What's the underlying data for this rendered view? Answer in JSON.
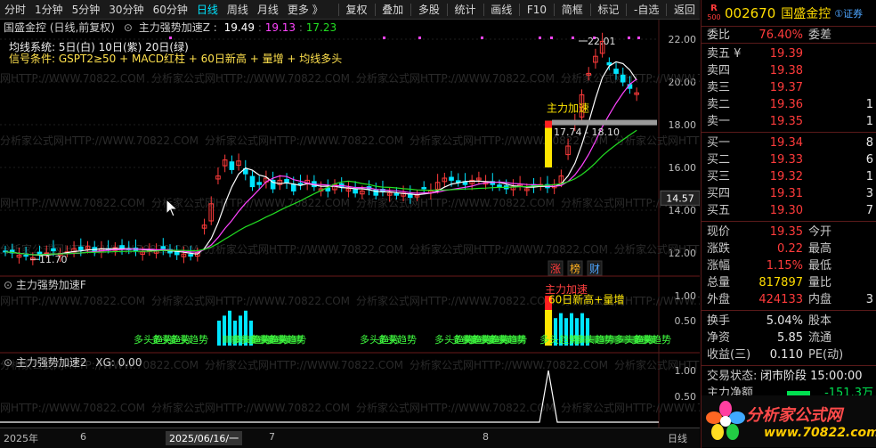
{
  "toolbar": {
    "items": [
      "分时",
      "1分钟",
      "5分钟",
      "30分钟",
      "60分钟",
      "日线",
      "周线",
      "月线",
      "更多 》"
    ],
    "right_items": [
      "复权",
      "叠加",
      "多股",
      "统计",
      "画线",
      "F10",
      "简框",
      "标记",
      "-自选",
      "返回"
    ],
    "active": "日线"
  },
  "main_panel": {
    "title": "国盛金控 (日线,前复权)",
    "indicator_name": "主力强势加速Z :",
    "v1": "19.49",
    "v2": "19.13",
    "v3": "17.23",
    "legend1": "均线系统: 5日(白) 10日(紫) 20日(绿)",
    "legend2": "信号条件: GSPT2≥50 + MACD红柱 + 60日新高 + 量增 + 均线多头",
    "annot_label": "主力加速",
    "annot_range": "17.74 - 18.10",
    "high_label": "22.01",
    "low_label": "11.70",
    "badges": [
      "涨",
      "榜",
      "财"
    ],
    "watermark_text": "分析家公式网HTTP://WWW.70822.COM",
    "y_ticks": [
      "22.00",
      "20.00",
      "18.00",
      "16.00",
      "14.00",
      "12.00"
    ],
    "price_tag": "14.57"
  },
  "panel2": {
    "title": "主力强势加速F",
    "signal_label": "60日新高+量增",
    "signal_label2": "主力加速",
    "trend_label": "多头趋势",
    "y_ticks": [
      "1.00",
      "0.50"
    ]
  },
  "panel3": {
    "title": "主力强势加速2",
    "xg_label": "XG: 0.00",
    "y_ticks": [
      "1.00",
      "0.50"
    ]
  },
  "timeline": {
    "labels": [
      "2025年",
      "6",
      "2025/06/16/一",
      "7",
      "8",
      "日线"
    ]
  },
  "quote": {
    "code": "002670",
    "name": "国盛金控",
    "badge": "R",
    "badge_sub": "500",
    "tag": "①证券",
    "weibi_label": "委比",
    "weibi": "76.40%",
    "weicha_label": "委差",
    "sells": [
      {
        "label": "卖五 ¥",
        "price": "19.39",
        "vol": ""
      },
      {
        "label": "卖四",
        "price": "19.38",
        "vol": ""
      },
      {
        "label": "卖三",
        "price": "19.37",
        "vol": ""
      },
      {
        "label": "卖二",
        "price": "19.36",
        "vol": "1"
      },
      {
        "label": "卖一",
        "price": "19.35",
        "vol": "1"
      }
    ],
    "buys": [
      {
        "label": "买一",
        "price": "19.34",
        "vol": "8"
      },
      {
        "label": "买二",
        "price": "19.33",
        "vol": "6"
      },
      {
        "label": "买三",
        "price": "19.32",
        "vol": "1"
      },
      {
        "label": "买四",
        "price": "19.31",
        "vol": "3"
      },
      {
        "label": "买五",
        "price": "19.30",
        "vol": "7"
      }
    ],
    "stats": [
      {
        "l1": "现价",
        "v1": "19.35",
        "c1": "red",
        "l2": "今开",
        "v2": ""
      },
      {
        "l1": "涨跌",
        "v1": "0.22",
        "c1": "red",
        "l2": "最高",
        "v2": ""
      },
      {
        "l1": "涨幅",
        "v1": "1.15%",
        "c1": "red",
        "l2": "最低",
        "v2": ""
      },
      {
        "l1": "总量",
        "v1": "817897",
        "c1": "yellow",
        "l2": "量比",
        "v2": ""
      },
      {
        "l1": "外盘",
        "v1": "424133",
        "c1": "red",
        "l2": "内盘",
        "v2": "3"
      }
    ],
    "stats2": [
      {
        "l1": "换手",
        "v1": "5.04%",
        "c1": "white",
        "l2": "股本",
        "v2": ""
      },
      {
        "l1": "净资",
        "v1": "5.85",
        "c1": "white",
        "l2": "流通",
        "v2": ""
      },
      {
        "l1": "收益(三)",
        "v1": "0.110",
        "c1": "white",
        "l2": "PE(动)",
        "v2": ""
      }
    ],
    "status_label": "交易状态:",
    "status": "闭市阶段 15:00:00",
    "flow_label": "主力净额",
    "flow_value": "-151.3万",
    "logo_text": "分析家公式网",
    "logo_url": "www.70822.com"
  },
  "colors": {
    "up": "#ff3b3b",
    "down": "#00e5ff",
    "ma5": "#ffffff",
    "ma10": "#ff44ff",
    "ma20": "#22dd22"
  }
}
